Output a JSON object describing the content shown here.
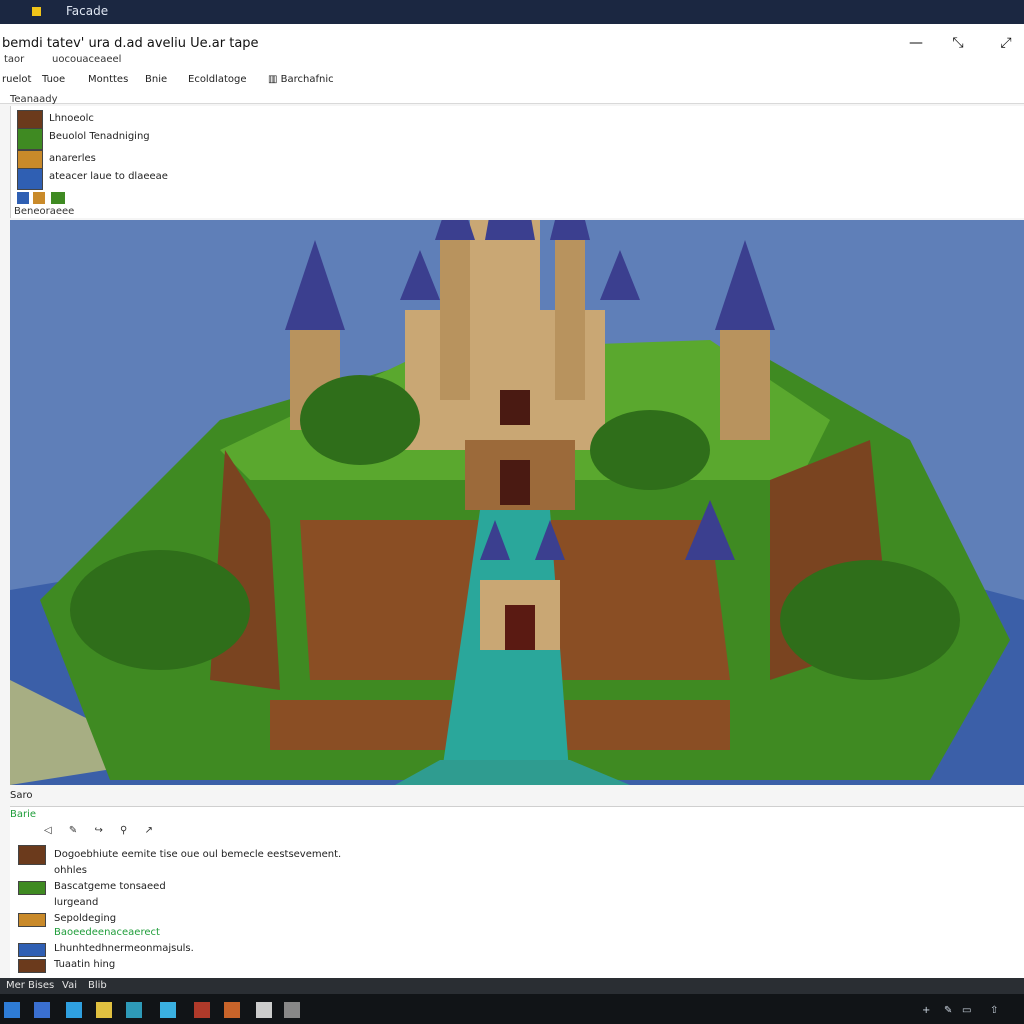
{
  "titlebar": {
    "title": "Facade"
  },
  "header": {
    "doc_title": "bemdi tatev' ura d.ad aveliu Ue.ar tape",
    "sub_left": "taor",
    "sub_right": "uocouaceaeel",
    "window_controls": [
      "—",
      "⤡",
      "⤢"
    ]
  },
  "menu": [
    "ruelot",
    "Tuoe",
    "Monttes",
    "Bnie",
    "Ecoldlatoge",
    "Barchafnic"
  ],
  "layers_label": "Teanaady",
  "assets": [
    {
      "label": "Lhnoeolc"
    },
    {
      "label": "Beuolol Tenadniging"
    },
    {
      "label": "anarerles"
    },
    {
      "label": "ateacer laue to dlaeeae"
    }
  ],
  "assets_footer": "Beneoraeee",
  "status_label": "Saro",
  "console": {
    "tab": "Barie",
    "tools": [
      "◁",
      "✎",
      "↪",
      "⚲",
      "↗"
    ],
    "logs": [
      {
        "text": "Dogoebhiute eemite tise oue oul bemecle eestsevement.",
        "green": false
      },
      {
        "text": "ohhles",
        "green": false
      },
      {
        "text": "Bascatgeme tonsaeed",
        "green": false
      },
      {
        "text": "lurgeand",
        "green": false
      },
      {
        "text": "Sepoldeging",
        "green": false
      },
      {
        "text": "Baoeedeenaceaerect",
        "green": true
      },
      {
        "text": "Lhunhtedhnermeonmajsuls.",
        "green": false
      },
      {
        "text": "Tuaatin hing",
        "green": false
      }
    ]
  },
  "taskbar": {
    "strip": [
      "Mer",
      "Bises",
      "Vai",
      "Blib"
    ],
    "icons": [
      "windows-icon",
      "explorer-icon",
      "code-icon",
      "files-icon",
      "tool-icon",
      "grid-icon",
      "app-icon",
      "paint-icon",
      "search-icon",
      "edit-icon"
    ],
    "tray": [
      "+",
      "✎",
      "▭",
      "⇧"
    ]
  },
  "colors": {
    "sky": "#5f7fb8",
    "water": "#3b5fa8",
    "grass": "#3f8a22",
    "cliff": "#8a4e24",
    "roof": "#3b3f8f",
    "stone": "#c9a774",
    "moat": "#2aa79b"
  }
}
